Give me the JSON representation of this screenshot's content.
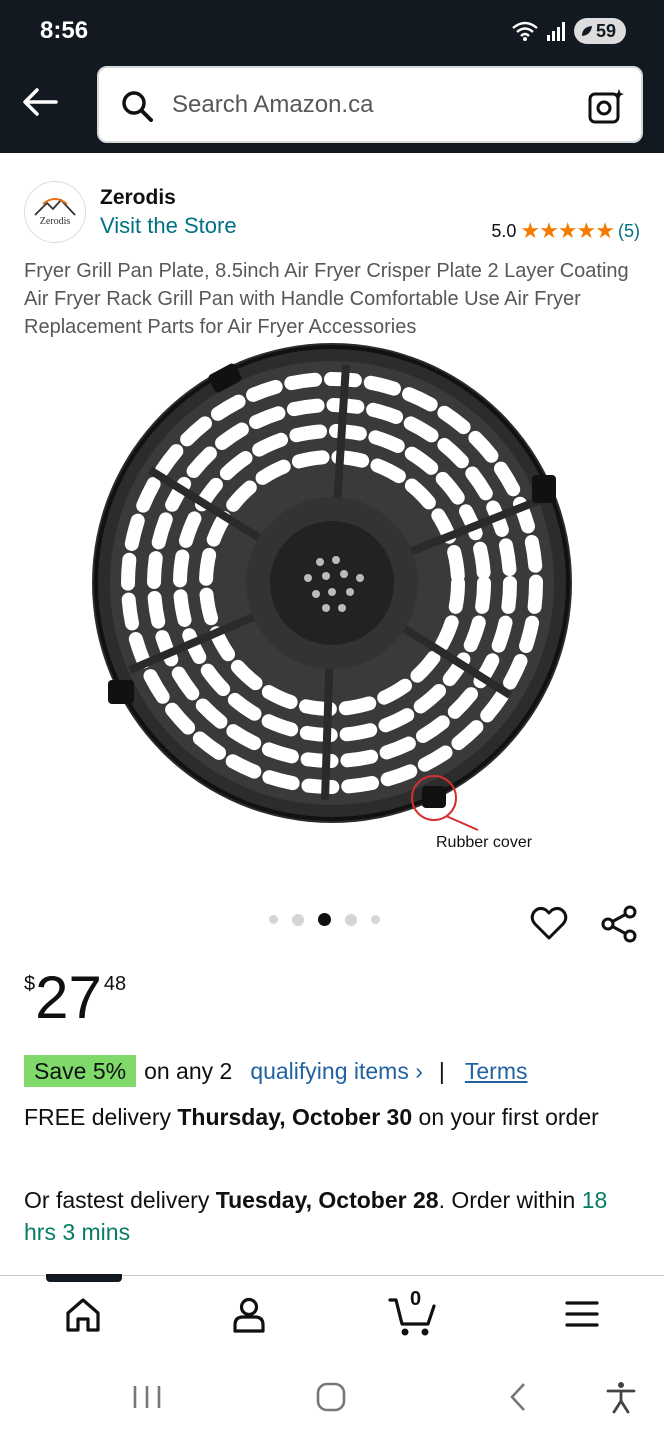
{
  "status_bar": {
    "time": "8:56",
    "battery": "59"
  },
  "header": {
    "search_placeholder": "Search Amazon.ca"
  },
  "store": {
    "logo_text": "Zerodis",
    "name": "Zerodis",
    "visit_label": "Visit the Store",
    "rating": "5.0",
    "stars": "★★★★★",
    "review_count": "(5)"
  },
  "product": {
    "title": "Fryer Grill Pan Plate, 8.5inch Air Fryer Crisper Plate 2 Layer Coating Air Fryer Rack Grill Pan with Handle Comfortable Use Air Fryer Replacement Parts for Air Fryer Accessories",
    "image_callout": "Rubber cover",
    "carousel": {
      "count": 5,
      "active_index": 2
    }
  },
  "price": {
    "symbol": "$",
    "whole": "27",
    "fraction": "48"
  },
  "promo": {
    "badge": "Save 5%",
    "text": "on any 2",
    "link": "qualifying items ›",
    "separator": "|",
    "terms": "Terms"
  },
  "delivery": {
    "prefix": "FREE delivery ",
    "date": "Thursday, October 30",
    "suffix": " on your first order"
  },
  "fastest": {
    "prefix": "Or fastest delivery ",
    "date": "Tuesday, October 28",
    "middle": ". Order within ",
    "countdown": "18 hrs 3 mins"
  },
  "bottom_nav": {
    "cart_count": "0"
  },
  "colors": {
    "header_bg": "#131921",
    "link": "#007185",
    "star": "#f57c00",
    "badge": "#7fda69",
    "countdown": "#067d62"
  }
}
